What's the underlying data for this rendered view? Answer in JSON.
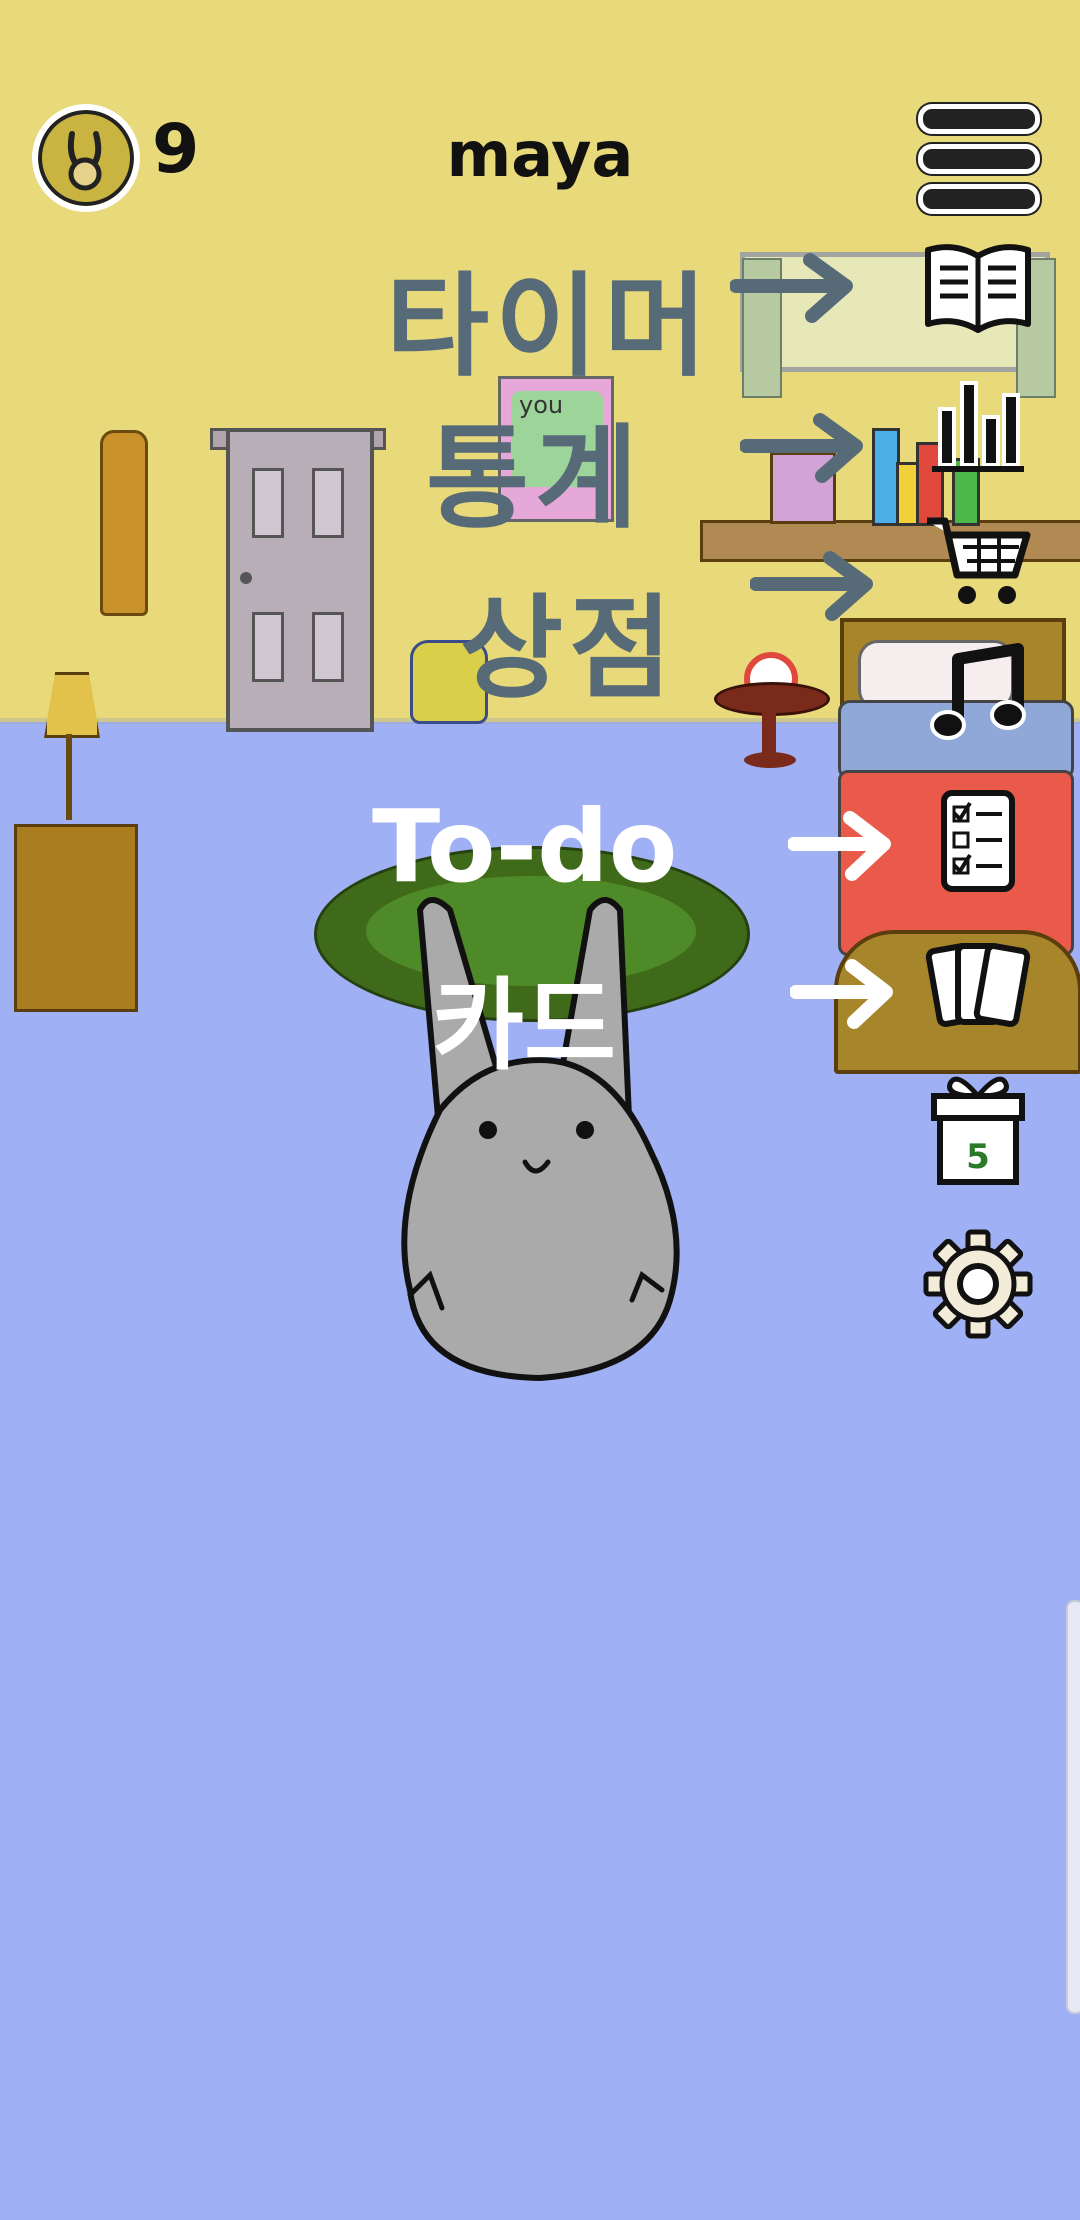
{
  "hud": {
    "coin_count": "9",
    "username": "maya"
  },
  "side_menu": [
    {
      "name": "timer",
      "icon": "book-icon"
    },
    {
      "name": "stats",
      "icon": "bar-chart-icon"
    },
    {
      "name": "shop",
      "icon": "shopping-cart-icon"
    },
    {
      "name": "music",
      "icon": "music-note-icon"
    },
    {
      "name": "todo",
      "icon": "checklist-icon"
    },
    {
      "name": "cards",
      "icon": "cards-icon"
    },
    {
      "name": "gift",
      "icon": "gift-icon",
      "badge": "5"
    },
    {
      "name": "settings",
      "icon": "gear-icon"
    }
  ],
  "annotations": {
    "timer": "타이머",
    "stats": "통계",
    "shop": "상점",
    "todo": "To-do",
    "cards": "카드"
  },
  "scene": {
    "poster_text": "you"
  },
  "colors": {
    "wall": "#e8d97a",
    "floor": "#a0b0f4",
    "annotation_dark": "#566a78",
    "annotation_light": "#ffffff"
  }
}
